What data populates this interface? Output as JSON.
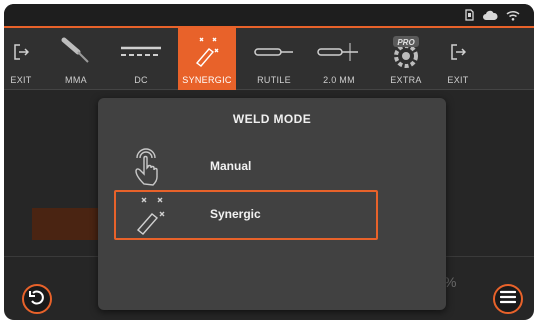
{
  "status_bar": {
    "icons": [
      "sd-card-icon",
      "cloud-icon",
      "wifi-icon"
    ],
    "accent_color": "#e8622a"
  },
  "menu": {
    "items": [
      {
        "label": "EXIT",
        "icon": "exit-icon"
      },
      {
        "label": "MMA",
        "icon": "electrode-holder-icon"
      },
      {
        "label": "DC",
        "icon": "dc-current-icon"
      },
      {
        "label": "SYNERGIC",
        "icon": "synergic-icon",
        "active": true
      },
      {
        "label": "RUTILE",
        "icon": "rutile-electrode-icon"
      },
      {
        "label": "2.0 MM",
        "icon": "electrode-diameter-icon"
      },
      {
        "label": "EXTRA",
        "icon": "pro-gear-icon",
        "badge": "PRO"
      },
      {
        "label": "EXIT",
        "icon": "exit-icon"
      }
    ]
  },
  "background": {
    "percent_symbol": "%"
  },
  "modal": {
    "title": "WELD MODE",
    "options": [
      {
        "label": "Manual",
        "icon": "hand-touch-icon",
        "selected": false
      },
      {
        "label": "Synergic",
        "icon": "synergic-icon",
        "selected": true
      }
    ]
  },
  "buttons": {
    "back_icon": "undo-icon",
    "menu_icon": "hamburger-menu-icon"
  }
}
